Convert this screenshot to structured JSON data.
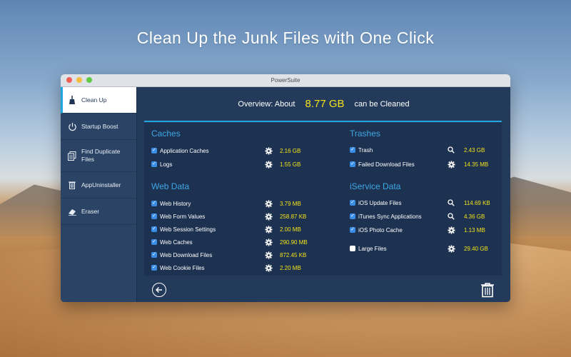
{
  "headline": "Clean Up the Junk Files with One Click",
  "window": {
    "title": "PowerSuite"
  },
  "sidebar": {
    "items": [
      {
        "label": "Clean Up",
        "icon": "broom-icon",
        "active": true
      },
      {
        "label": "Startup Boost",
        "icon": "power-icon"
      },
      {
        "label": "Find Duplicate Files",
        "icon": "duplicate-files-icon"
      },
      {
        "label": "AppUninstaller",
        "icon": "trash-icon"
      },
      {
        "label": "Eraser",
        "icon": "eraser-icon"
      }
    ]
  },
  "overview": {
    "prefix": "Overview: About",
    "amount": "8.77 GB",
    "suffix": "can be Cleaned"
  },
  "sections": {
    "caches": {
      "title": "Caches",
      "rows": [
        {
          "label": "Application Caches",
          "size": "2.16 GB",
          "checked": true,
          "action": "gear-icon"
        },
        {
          "label": "Logs",
          "size": "1.55 GB",
          "checked": true,
          "action": "gear-icon"
        }
      ]
    },
    "web": {
      "title": "Web Data",
      "rows": [
        {
          "label": "Web History",
          "size": "3.79 MB",
          "checked": true,
          "action": "gear-icon"
        },
        {
          "label": "Web Form Values",
          "size": "258.87 KB",
          "checked": true,
          "action": "gear-icon"
        },
        {
          "label": "Web Session Settings",
          "size": "2.00 MB",
          "checked": true,
          "action": "gear-icon"
        },
        {
          "label": "Web Caches",
          "size": "290.90 MB",
          "checked": true,
          "action": "gear-icon"
        },
        {
          "label": "Web Download Files",
          "size": "872.45 KB",
          "checked": true,
          "action": "gear-icon"
        },
        {
          "label": "Web Cookie Files",
          "size": "2.20 MB",
          "checked": true,
          "action": "gear-icon"
        }
      ]
    },
    "trashes": {
      "title": "Trashes",
      "rows": [
        {
          "label": "Trash",
          "size": "2.43 GB",
          "checked": true,
          "action": "magnifier-icon"
        },
        {
          "label": "Failed Download Files",
          "size": "14.35 MB",
          "checked": true,
          "action": "gear-icon"
        }
      ]
    },
    "iservice": {
      "title": "iService Data",
      "rows": [
        {
          "label": "iOS Update Files",
          "size": "114.69 KB",
          "checked": true,
          "action": "magnifier-icon"
        },
        {
          "label": "iTunes Sync Applications",
          "size": "4.36 GB",
          "checked": true,
          "action": "magnifier-icon"
        },
        {
          "label": "iOS Photo Cache",
          "size": "1.13 MB",
          "checked": true,
          "action": "gear-icon"
        },
        {
          "label": "Large Files",
          "size": "29.40 GB",
          "checked": false,
          "action": "gear-icon"
        }
      ]
    }
  },
  "colors": {
    "accent": "#22a6df",
    "size_text": "#f3e31a",
    "section_title": "#3fa7e6",
    "window_bg": "#233a5a"
  }
}
